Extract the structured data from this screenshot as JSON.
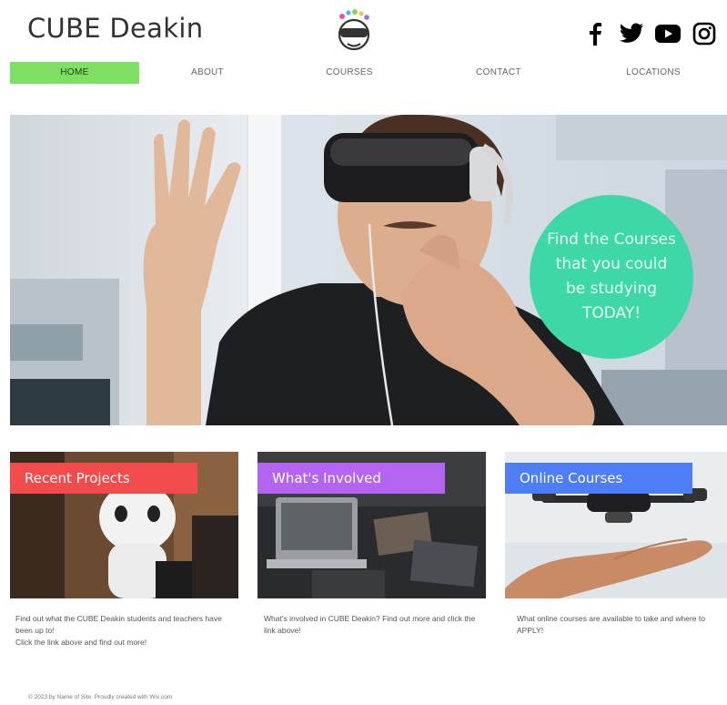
{
  "site": {
    "title": "CUBE Deakin"
  },
  "nav": {
    "items": [
      {
        "label": "HOME"
      },
      {
        "label": "ABOUT"
      },
      {
        "label": "COURSES"
      },
      {
        "label": "CONTACT"
      },
      {
        "label": "LOCATIONS"
      }
    ],
    "active_index": 0
  },
  "socials": [
    "facebook-icon",
    "twitter-icon",
    "youtube-icon",
    "instagram-icon"
  ],
  "hero": {
    "circle_text": "Find the Courses that you could be studying TODAY!",
    "circle_color": "#3ed7a6"
  },
  "cards": [
    {
      "label": "Recent Projects",
      "label_color": "#f24b4b",
      "description_lines": [
        "Find out what the CUBE Deakin students and teachers have been up to!",
        "Click the link above and find out more!"
      ]
    },
    {
      "label": "What's Involved",
      "label_color": "#b364f0",
      "description_lines": [
        "What's involved in CUBE Deakin? Find out more and click the link above!"
      ]
    },
    {
      "label": "Online Courses",
      "label_color": "#4d7ef7",
      "description_lines": [
        "What online courses are available to take and where to APPLY!"
      ]
    }
  ],
  "footer": {
    "text": "© 2023 by Name of Site. Proudly created with Wix.com"
  },
  "colors": {
    "nav_active": "#7ee062"
  }
}
